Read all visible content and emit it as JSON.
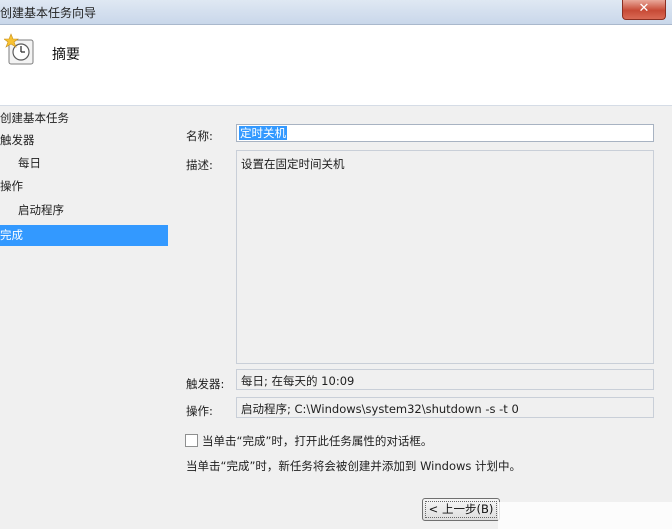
{
  "window": {
    "title": "创建基本任务向导",
    "close_glyph": "✕"
  },
  "header": {
    "title": "摘要",
    "icon": "task-clock-icon"
  },
  "nav": {
    "items": [
      {
        "label": "创建基本任务"
      },
      {
        "label": "触发器"
      },
      {
        "label": "每日"
      },
      {
        "label": "操作"
      },
      {
        "label": "启动程序"
      },
      {
        "label": "完成"
      }
    ]
  },
  "form": {
    "name_label": "名称:",
    "name_value": "定时关机",
    "desc_label": "描述:",
    "desc_value": "设置在固定时间关机",
    "trigger_label": "触发器:",
    "trigger_value": "每日; 在每天的 10:09",
    "action_label": "操作:",
    "action_value": "启动程序; C:\\Windows\\system32\\shutdown -s -t 0",
    "checkbox_label": "当单击“完成”时，打开此任务属性的对话框。",
    "checkbox_checked": false,
    "note": "当单击“完成”时，新任务将会被创建并添加到 Windows 计划中。"
  },
  "buttons": {
    "back": "< 上一步(B)"
  },
  "colors": {
    "selection": "#3399ff",
    "panel": "#f0f0f0",
    "close": "#c74a36"
  }
}
